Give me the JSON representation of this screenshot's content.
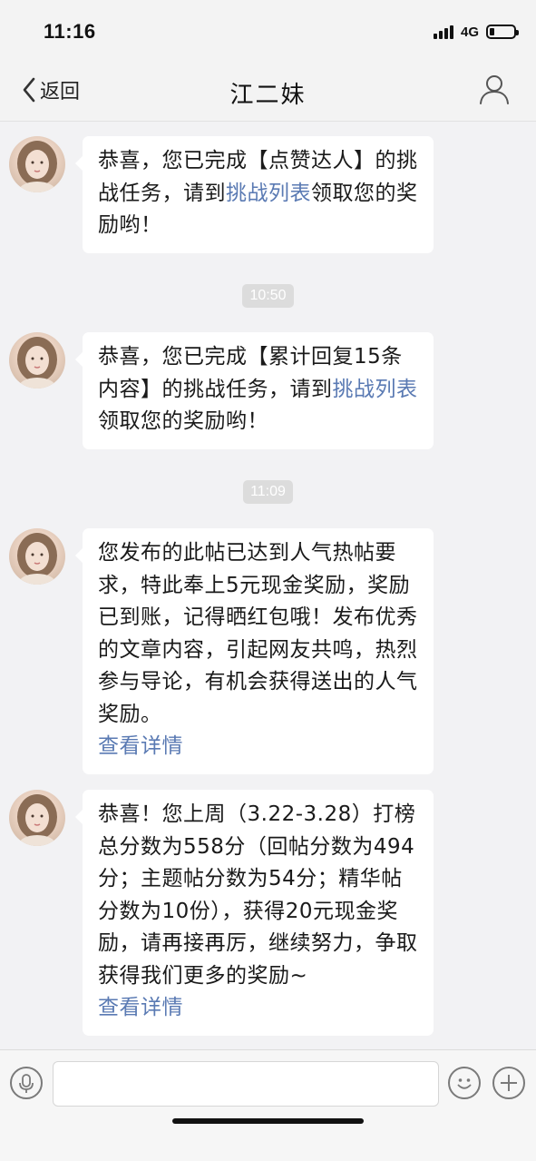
{
  "status_bar": {
    "time": "11:16",
    "network": "4G",
    "battery_level": 0.2
  },
  "nav": {
    "back_label": "返回",
    "title": "江二妹",
    "icons": {
      "back": "chevron-left-icon",
      "profile": "person-icon"
    }
  },
  "messages": [
    {
      "parts": [
        {
          "text": "恭喜，您已完成【点赞达人】的挑战任务，请到"
        },
        {
          "text": "挑战列表",
          "link": true
        },
        {
          "text": "领取您的奖励哟！"
        }
      ]
    },
    {
      "timestamp": "10:50"
    },
    {
      "parts": [
        {
          "text": "恭喜，您已完成【累计回复15条内容】的挑战任务，请到"
        },
        {
          "text": "挑战列表",
          "link": true
        },
        {
          "text": "领取您的奖励哟！"
        }
      ]
    },
    {
      "timestamp": "11:09"
    },
    {
      "parts": [
        {
          "text": "您发布的此帖已达到人气热帖要求，特此奉上5元现金奖励，奖励已到账，记得晒红包哦！发布优秀的文章内容，引起网友共鸣，热烈参与导论，有机会获得送出的人气奖励。"
        }
      ],
      "link_label": "查看详情"
    },
    {
      "parts": [
        {
          "text": "恭喜！您上周（3.22-3.28）打榜总分数为558分（回帖分数为494分；主题帖分数为54分；精华帖分数为10份），获得20元现金奖励，请再接再厉，继续努力，争取获得我们更多的奖励~"
        }
      ],
      "link_label": "查看详情"
    }
  ],
  "input_bar": {
    "placeholder": "",
    "icons": {
      "voice": "microphone-icon",
      "emoji": "smiley-icon",
      "more": "plus-icon"
    }
  },
  "colors": {
    "background": "#f2f2f4",
    "bubble": "#ffffff",
    "link": "#5a7ab3",
    "timestamp_bg": "#dcdcdc"
  }
}
